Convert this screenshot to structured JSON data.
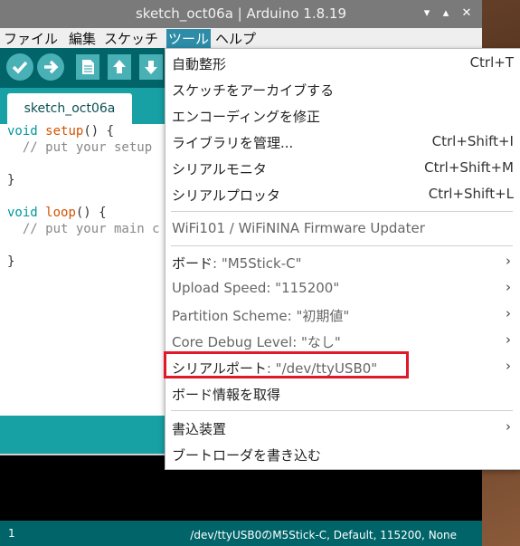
{
  "window": {
    "title": "sketch_oct06a | Arduino 1.8.19",
    "controls": [
      "▾",
      "▴",
      "✕"
    ]
  },
  "menubar": {
    "file": "ファイル",
    "edit": "編集",
    "sketch": "スケッチ",
    "tools": "ツール",
    "help": "ヘルプ"
  },
  "toolbar": {
    "icons": [
      "check-icon",
      "arrow-right-icon",
      "new-document-icon",
      "open-arrow-up-icon",
      "save-arrow-down-icon"
    ]
  },
  "tab": {
    "label": "sketch_oct06a"
  },
  "code": {
    "l1_kw": "void ",
    "l1_fn": "setup",
    "l1_rest": "() {",
    "l2": "  // put your setup",
    "l4": "}",
    "l6_kw": "void ",
    "l6_fn": "loop",
    "l6_rest": "() {",
    "l7": "  // put your main c",
    "l9": "}"
  },
  "footer": {
    "line": "1",
    "info": "/dev/ttyUSB0のM5Stick-C, Default, 115200, None"
  },
  "tools_menu": {
    "autoformat": {
      "label": "自動整形",
      "shortcut": "Ctrl+T"
    },
    "archive": {
      "label": "スケッチをアーカイブする"
    },
    "fix_encoding": {
      "label": "エンコーディングを修正"
    },
    "manage_libs": {
      "label": "ライブラリを管理...",
      "shortcut": "Ctrl+Shift+I"
    },
    "serial_monitor": {
      "label": "シリアルモニタ",
      "shortcut": "Ctrl+Shift+M"
    },
    "serial_plotter": {
      "label": "シリアルプロッタ",
      "shortcut": "Ctrl+Shift+L"
    },
    "wifi_updater": {
      "label": "WiFi101 / WiFiNINA Firmware Updater"
    },
    "board": {
      "name": "ボード",
      "value": ": \"M5Stick-C\""
    },
    "upload_speed": {
      "name": "Upload Speed",
      "value": ": \"115200\""
    },
    "partition": {
      "name": "Partition Scheme",
      "value": ": \"初期値\""
    },
    "core_debug": {
      "name": "Core Debug Level",
      "value": ": \"なし\""
    },
    "serial_port": {
      "name": "シリアルポート",
      "value": ": \"/dev/ttyUSB0\""
    },
    "board_info": {
      "label": "ボード情報を取得"
    },
    "programmer": {
      "label": "書込装置"
    },
    "burn_bootloader": {
      "label": "ブートローダを書き込む"
    },
    "submenu_arrow": "›"
  },
  "colors": {
    "accent": "#17a1a5",
    "toolbar": "#006468",
    "highlight_border": "#e0182a"
  }
}
